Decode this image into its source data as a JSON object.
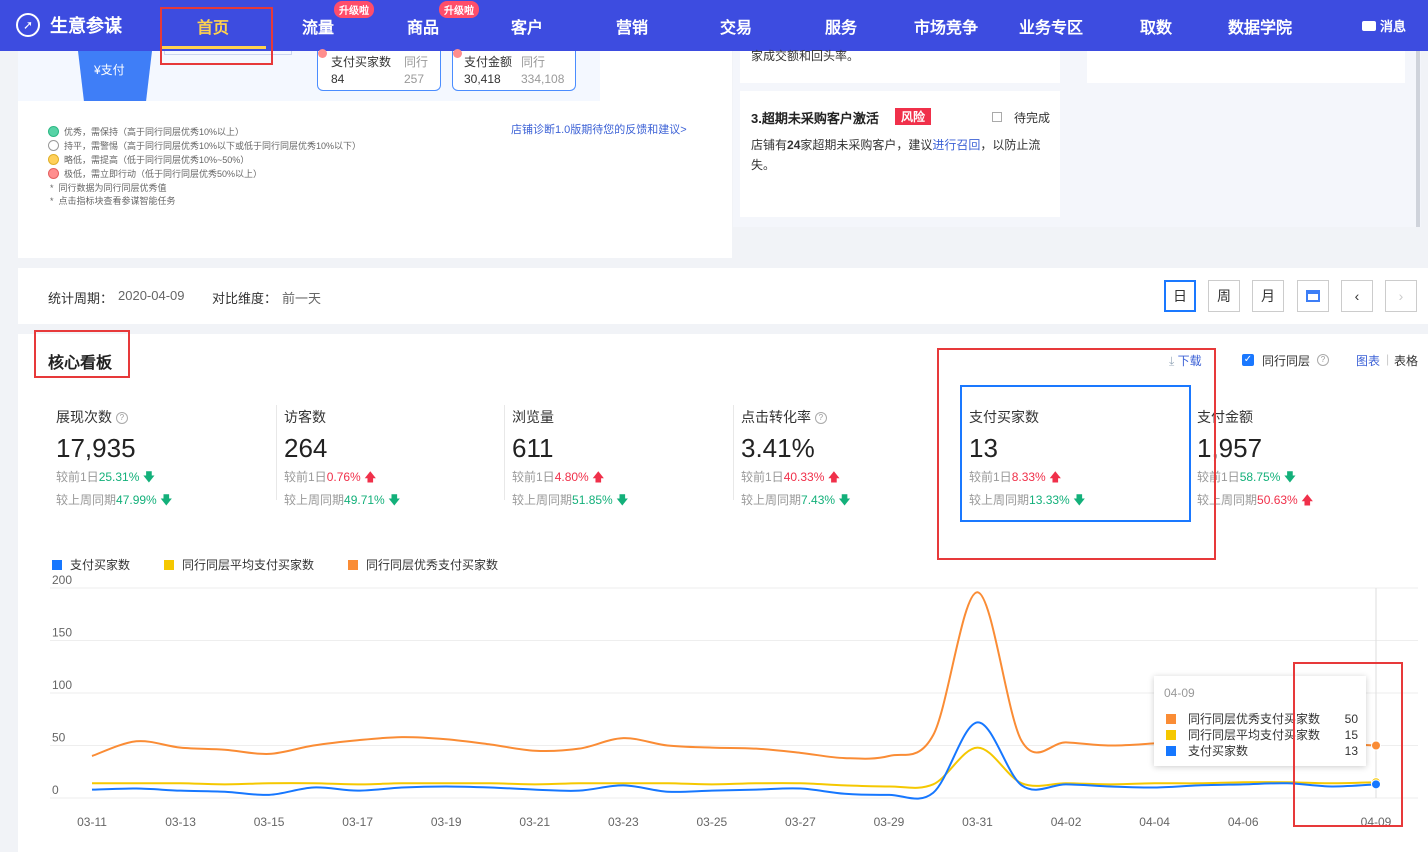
{
  "nav": {
    "brand": "生意参谋",
    "items": [
      {
        "label": "首页",
        "active": true
      },
      {
        "label": "流量",
        "badge": "升级啦"
      },
      {
        "label": "商品",
        "badge": "升级啦"
      },
      {
        "label": "客户"
      },
      {
        "label": "营销"
      },
      {
        "label": "交易"
      },
      {
        "label": "服务"
      },
      {
        "label": "市场竞争"
      },
      {
        "label": "业务专区"
      },
      {
        "label": "取数"
      },
      {
        "label": "数据学院"
      }
    ],
    "message": "消息",
    "accent": "#3d4ce0"
  },
  "top": {
    "funnel_label": "¥支付",
    "buyers": {
      "label": "支付买家数",
      "peer": "同行",
      "value": "84",
      "peer_value": "257"
    },
    "amount": {
      "label": "支付金额",
      "peer": "同行",
      "value": "30,418",
      "peer_value": "334,108"
    },
    "legend": [
      {
        "text": "优秀，需保持（高于同行同层优秀10%以上）",
        "color": "#57d3a6"
      },
      {
        "text": "持平，需警惕（高于同行同层优秀10%以下或低于同行同层优秀10%以下）",
        "color": "#ffffff"
      },
      {
        "text": "略低，需提高（低于同行同层优秀10%~50%）",
        "color": "#ffd05a"
      },
      {
        "text": "极低，需立即行动（低于同行同层优秀50%以上）",
        "color": "#ff8e8e"
      }
    ],
    "notes": [
      "同行数据为同行同层优秀值",
      "点击指标块查看参谋智能任务"
    ],
    "feedback_link": "店铺诊断1.0版期待您的反馈和建议>",
    "task_partial": "家成交额和回头率。",
    "task": {
      "title": "3.超期未采购客户激活",
      "tag": "风险",
      "status": "待完成",
      "desc_a": "店铺有",
      "desc_num": "24",
      "desc_b": "家超期未采购客户，建议",
      "desc_link": "进行召回",
      "desc_c": "，以防止流失。"
    }
  },
  "period": {
    "label": "统计周期：",
    "date": "2020-04-09",
    "compare_label": "对比维度：",
    "compare_value": "前一天",
    "buttons": [
      "日",
      "周",
      "月"
    ]
  },
  "board": {
    "title": "核心看板",
    "download": "下载",
    "peer_toggle": "同行同层",
    "view_chart": "图表",
    "view_table": "表格",
    "kpis": [
      {
        "title": "展现次数",
        "help": true,
        "value": "17,935",
        "d1_label": "较前1日",
        "d1": "25.31%",
        "d1_dir": "down",
        "w_label": "较上周同期",
        "w": "47.99%",
        "w_dir": "down"
      },
      {
        "title": "访客数",
        "help": false,
        "value": "264",
        "d1_label": "较前1日",
        "d1": "0.76%",
        "d1_dir": "up",
        "w_label": "较上周同期",
        "w": "49.71%",
        "w_dir": "down"
      },
      {
        "title": "浏览量",
        "help": false,
        "value": "611",
        "d1_label": "较前1日",
        "d1": "4.80%",
        "d1_dir": "up",
        "w_label": "较上周同期",
        "w": "51.85%",
        "w_dir": "down"
      },
      {
        "title": "点击转化率",
        "help": true,
        "value": "3.41%",
        "d1_label": "较前1日",
        "d1": "40.33%",
        "d1_dir": "up",
        "w_label": "较上周同期",
        "w": "7.43%",
        "w_dir": "down"
      },
      {
        "title": "支付买家数",
        "help": false,
        "value": "13",
        "d1_label": "较前1日",
        "d1": "8.33%",
        "d1_dir": "up",
        "w_label": "较上周同期",
        "w": "13.33%",
        "w_dir": "down"
      },
      {
        "title": "支付金额",
        "help": false,
        "value": "1,957",
        "d1_label": "较前1日",
        "d1": "58.75%",
        "d1_dir": "down",
        "w_label": "较上周同期",
        "w": "50.63%",
        "w_dir": "up"
      }
    ]
  },
  "chart_data": {
    "type": "line",
    "x": [
      "03-11",
      "03-12",
      "03-13",
      "03-14",
      "03-15",
      "03-16",
      "03-17",
      "03-18",
      "03-19",
      "03-20",
      "03-21",
      "03-22",
      "03-23",
      "03-24",
      "03-25",
      "03-26",
      "03-27",
      "03-28",
      "03-29",
      "03-30",
      "03-31",
      "04-01",
      "04-02",
      "04-03",
      "04-04",
      "04-05",
      "04-06",
      "04-07",
      "04-08",
      "04-09"
    ],
    "x_tick_labels": [
      "03-11",
      "03-13",
      "03-15",
      "03-17",
      "03-19",
      "03-21",
      "03-23",
      "03-25",
      "03-27",
      "03-29",
      "03-31",
      "04-02",
      "04-04",
      "04-06",
      "04-09"
    ],
    "ylim": [
      0,
      200
    ],
    "yticks": [
      0,
      50,
      100,
      150,
      200
    ],
    "series": [
      {
        "name": "支付买家数",
        "color": "#1677ff",
        "values": [
          8,
          9,
          7,
          6,
          3,
          10,
          7,
          10,
          11,
          10,
          8,
          7,
          12,
          6,
          7,
          8,
          9,
          4,
          3,
          5,
          72,
          12,
          13,
          11,
          10,
          12,
          13,
          14,
          11,
          13
        ]
      },
      {
        "name": "同行同层平均支付买家数",
        "color": "#f5c800",
        "values": [
          14,
          14,
          14,
          13,
          14,
          14,
          13,
          14,
          14,
          14,
          13,
          14,
          14,
          14,
          13,
          14,
          14,
          12,
          11,
          13,
          48,
          14,
          14,
          13,
          14,
          14,
          15,
          15,
          14,
          15
        ]
      },
      {
        "name": "同行同层优秀支付买家数",
        "color": "#fa8c35",
        "values": [
          40,
          54,
          48,
          46,
          42,
          50,
          55,
          58,
          56,
          51,
          45,
          47,
          57,
          50,
          48,
          47,
          43,
          38,
          40,
          60,
          196,
          54,
          53,
          50,
          52,
          55,
          57,
          56,
          52,
          50
        ]
      }
    ],
    "tooltip": {
      "date": "04-09",
      "rows": [
        {
          "name": "同行同层优秀支付买家数",
          "value": "50",
          "color": "#fa8c35"
        },
        {
          "name": "同行同层平均支付买家数",
          "value": "15",
          "color": "#f5c800"
        },
        {
          "name": "支付买家数",
          "value": "13",
          "color": "#1677ff"
        }
      ]
    }
  }
}
